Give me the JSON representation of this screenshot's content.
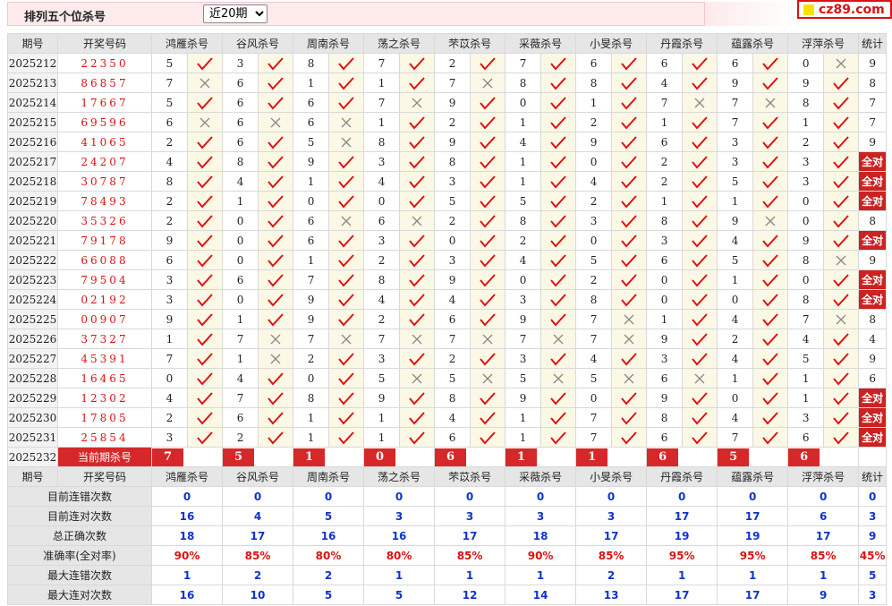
{
  "header": {
    "title": "排列五个位杀号",
    "period_select": {
      "selected": "近20期",
      "options": [
        "近20期"
      ]
    }
  },
  "logo": {
    "text": "cz89.com"
  },
  "columns": {
    "issue": "期号",
    "code": "开奖号码",
    "experts": [
      "鸿雁杀号",
      "谷风杀号",
      "周南杀号",
      "荡之杀号",
      "芣苡杀号",
      "采薇杀号",
      "小旻杀号",
      "丹霞杀号",
      "蕴露杀号",
      "浮萍杀号"
    ],
    "stat": "统计"
  },
  "all_correct_label": "全对",
  "rows": [
    {
      "issue": "2025212",
      "code": "22350",
      "kills": [
        5,
        3,
        8,
        7,
        2,
        7,
        6,
        6,
        6,
        0
      ],
      "ok": [
        1,
        1,
        1,
        1,
        1,
        1,
        1,
        1,
        1,
        0
      ],
      "stat": "9"
    },
    {
      "issue": "2025213",
      "code": "86857",
      "kills": [
        7,
        6,
        1,
        1,
        7,
        8,
        8,
        4,
        9,
        9
      ],
      "ok": [
        0,
        1,
        1,
        1,
        0,
        1,
        1,
        1,
        1,
        1
      ],
      "stat": "8"
    },
    {
      "issue": "2025214",
      "code": "17667",
      "kills": [
        5,
        6,
        6,
        7,
        9,
        0,
        1,
        7,
        7,
        8
      ],
      "ok": [
        1,
        1,
        1,
        0,
        1,
        1,
        1,
        0,
        0,
        1
      ],
      "stat": "7"
    },
    {
      "issue": "2025215",
      "code": "69596",
      "kills": [
        6,
        6,
        6,
        1,
        2,
        1,
        2,
        1,
        7,
        1
      ],
      "ok": [
        0,
        0,
        0,
        1,
        1,
        1,
        1,
        1,
        1,
        1
      ],
      "stat": "7"
    },
    {
      "issue": "2025216",
      "code": "41065",
      "kills": [
        2,
        6,
        5,
        8,
        9,
        4,
        9,
        6,
        3,
        2
      ],
      "ok": [
        1,
        1,
        0,
        1,
        1,
        1,
        1,
        1,
        1,
        1
      ],
      "stat": "9"
    },
    {
      "issue": "2025217",
      "code": "24207",
      "kills": [
        4,
        8,
        9,
        3,
        8,
        1,
        0,
        2,
        3,
        3
      ],
      "ok": [
        1,
        1,
        1,
        1,
        1,
        1,
        1,
        1,
        1,
        1
      ],
      "stat": "全对"
    },
    {
      "issue": "2025218",
      "code": "30787",
      "kills": [
        8,
        4,
        1,
        4,
        3,
        1,
        4,
        2,
        5,
        3
      ],
      "ok": [
        1,
        1,
        1,
        1,
        1,
        1,
        1,
        1,
        1,
        1
      ],
      "stat": "全对"
    },
    {
      "issue": "2025219",
      "code": "78493",
      "kills": [
        2,
        1,
        0,
        0,
        5,
        5,
        2,
        1,
        1,
        0
      ],
      "ok": [
        1,
        1,
        1,
        1,
        1,
        1,
        1,
        1,
        1,
        1
      ],
      "stat": "全对"
    },
    {
      "issue": "2025220",
      "code": "35326",
      "kills": [
        2,
        0,
        6,
        6,
        2,
        8,
        3,
        8,
        9,
        0
      ],
      "ok": [
        1,
        1,
        0,
        0,
        1,
        1,
        1,
        1,
        0,
        1
      ],
      "stat": "8"
    },
    {
      "issue": "2025221",
      "code": "79178",
      "kills": [
        9,
        0,
        6,
        3,
        0,
        2,
        0,
        3,
        4,
        9
      ],
      "ok": [
        1,
        1,
        1,
        1,
        1,
        1,
        1,
        1,
        1,
        1
      ],
      "stat": "全对"
    },
    {
      "issue": "2025222",
      "code": "66088",
      "kills": [
        6,
        0,
        1,
        2,
        3,
        4,
        5,
        6,
        5,
        8
      ],
      "ok": [
        1,
        1,
        1,
        1,
        1,
        1,
        1,
        1,
        1,
        0
      ],
      "stat": "9"
    },
    {
      "issue": "2025223",
      "code": "79504",
      "kills": [
        3,
        6,
        7,
        8,
        9,
        0,
        2,
        0,
        1,
        0
      ],
      "ok": [
        1,
        1,
        1,
        1,
        1,
        1,
        1,
        1,
        1,
        1
      ],
      "stat": "全对"
    },
    {
      "issue": "2025224",
      "code": "02192",
      "kills": [
        3,
        0,
        9,
        4,
        4,
        3,
        8,
        0,
        0,
        8
      ],
      "ok": [
        1,
        1,
        1,
        1,
        1,
        1,
        1,
        1,
        1,
        1
      ],
      "stat": "全对"
    },
    {
      "issue": "2025225",
      "code": "00907",
      "kills": [
        9,
        1,
        9,
        2,
        6,
        9,
        7,
        1,
        4,
        7
      ],
      "ok": [
        1,
        1,
        1,
        1,
        1,
        1,
        0,
        1,
        1,
        0
      ],
      "stat": "8"
    },
    {
      "issue": "2025226",
      "code": "37327",
      "kills": [
        1,
        7,
        7,
        7,
        7,
        7,
        7,
        9,
        2,
        4
      ],
      "ok": [
        1,
        0,
        0,
        0,
        0,
        0,
        0,
        1,
        1,
        1
      ],
      "stat": "4"
    },
    {
      "issue": "2025227",
      "code": "45391",
      "kills": [
        7,
        1,
        2,
        3,
        2,
        3,
        4,
        3,
        4,
        5
      ],
      "ok": [
        1,
        0,
        1,
        1,
        1,
        1,
        1,
        1,
        1,
        1
      ],
      "stat": "9"
    },
    {
      "issue": "2025228",
      "code": "16465",
      "kills": [
        0,
        4,
        0,
        5,
        5,
        5,
        5,
        6,
        1,
        1
      ],
      "ok": [
        1,
        1,
        1,
        0,
        0,
        0,
        0,
        0,
        1,
        1
      ],
      "stat": "6"
    },
    {
      "issue": "2025229",
      "code": "12302",
      "kills": [
        4,
        7,
        8,
        9,
        8,
        9,
        0,
        9,
        0,
        1
      ],
      "ok": [
        1,
        1,
        1,
        1,
        1,
        1,
        1,
        1,
        1,
        1
      ],
      "stat": "全对"
    },
    {
      "issue": "2025230",
      "code": "17805",
      "kills": [
        2,
        6,
        1,
        1,
        4,
        1,
        7,
        8,
        4,
        3
      ],
      "ok": [
        1,
        1,
        1,
        1,
        1,
        1,
        1,
        1,
        1,
        1
      ],
      "stat": "全对"
    },
    {
      "issue": "2025231",
      "code": "25854",
      "kills": [
        3,
        2,
        1,
        1,
        6,
        1,
        7,
        6,
        7,
        6
      ],
      "ok": [
        1,
        1,
        1,
        1,
        1,
        1,
        1,
        1,
        1,
        1
      ],
      "stat": "全对"
    }
  ],
  "current": {
    "issue": "2025232",
    "label": "当前期杀号",
    "kills": [
      7,
      5,
      1,
      0,
      6,
      1,
      1,
      6,
      5,
      6
    ]
  },
  "summary": {
    "rows": [
      {
        "label": "目前连错次数",
        "values": [
          "0",
          "0",
          "0",
          "0",
          "0",
          "0",
          "0",
          "0",
          "0",
          "0",
          "0"
        ]
      },
      {
        "label": "目前连对次数",
        "values": [
          "16",
          "4",
          "5",
          "3",
          "3",
          "3",
          "3",
          "17",
          "17",
          "6",
          "3"
        ]
      },
      {
        "label": "总正确次数",
        "values": [
          "18",
          "17",
          "16",
          "16",
          "17",
          "18",
          "17",
          "19",
          "19",
          "17",
          "9"
        ]
      },
      {
        "label": "准确率(全对率)",
        "values": [
          "90%",
          "85%",
          "80%",
          "80%",
          "85%",
          "90%",
          "85%",
          "95%",
          "95%",
          "85%",
          "45%"
        ],
        "red": true
      },
      {
        "label": "最大连错次数",
        "values": [
          "1",
          "2",
          "2",
          "1",
          "1",
          "1",
          "2",
          "1",
          "1",
          "1",
          "5"
        ]
      },
      {
        "label": "最大连对次数",
        "values": [
          "16",
          "10",
          "5",
          "5",
          "12",
          "14",
          "13",
          "17",
          "17",
          "9",
          "3"
        ]
      }
    ]
  }
}
